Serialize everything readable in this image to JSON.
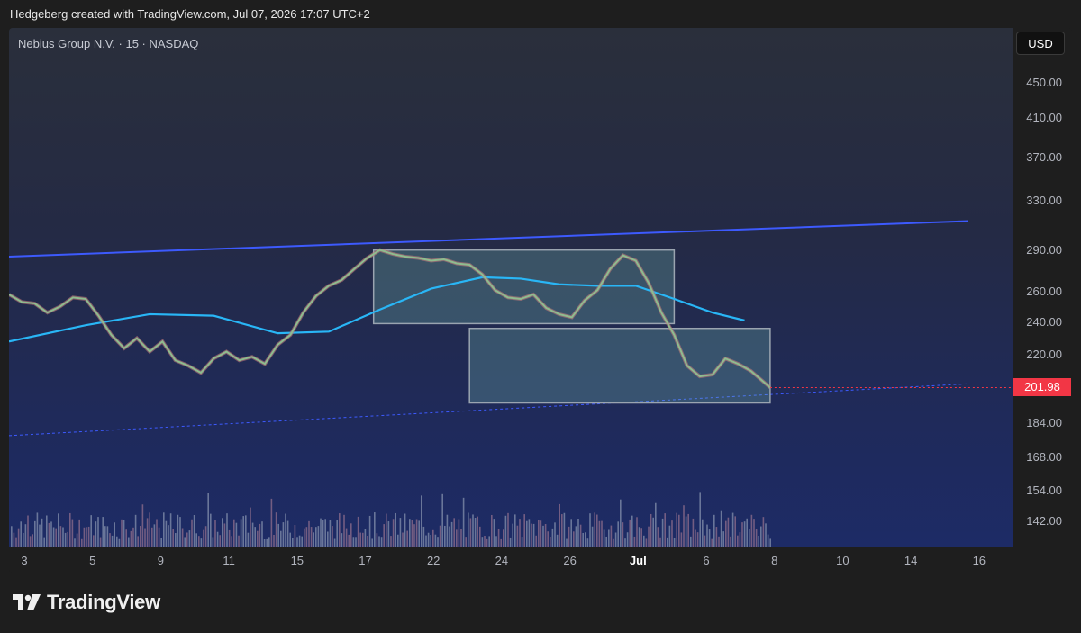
{
  "header": {
    "text": "Hedgeberg created with TradingView.com, Jul 07, 2026 17:07 UTC+2"
  },
  "legend": {
    "symbol": "Nebius Group N.V. · 15 · NASDAQ"
  },
  "currency": "USD",
  "last_price": "201.98",
  "footer": {
    "brand": "TradingView",
    "logo_icon": "tradingview-logo-icon"
  },
  "colors": {
    "trend_line": "#3d5afe",
    "ma_long": "#29b6f6",
    "ma_short": "#8fbc8f",
    "last_price_bg": "#f23645",
    "box_fill": "rgba(120,190,180,0.28)"
  },
  "chart_data": {
    "type": "line",
    "title": "",
    "xlabel": "",
    "ylabel": "",
    "scale": "log",
    "ylim": [
      133,
      520
    ],
    "price_ticks": [
      "450.00",
      "410.00",
      "370.00",
      "330.00",
      "290.00",
      "260.00",
      "240.00",
      "220.00",
      "201.98",
      "184.00",
      "168.00",
      "154.00",
      "142.00"
    ],
    "time_ticks": [
      {
        "label": "3",
        "bold": false
      },
      {
        "label": "5",
        "bold": false
      },
      {
        "label": "9",
        "bold": false
      },
      {
        "label": "11",
        "bold": false
      },
      {
        "label": "15",
        "bold": false
      },
      {
        "label": "17",
        "bold": false
      },
      {
        "label": "22",
        "bold": false
      },
      {
        "label": "24",
        "bold": false
      },
      {
        "label": "26",
        "bold": false
      },
      {
        "label": "Jul",
        "bold": true
      },
      {
        "label": "6",
        "bold": false
      },
      {
        "label": "8",
        "bold": false
      },
      {
        "label": "10",
        "bold": false
      },
      {
        "label": "14",
        "bold": false
      },
      {
        "label": "16",
        "bold": false
      }
    ],
    "price_series": [
      [
        0,
        258
      ],
      [
        2,
        253
      ],
      [
        4,
        252
      ],
      [
        6,
        246
      ],
      [
        8,
        250
      ],
      [
        10,
        256
      ],
      [
        12,
        255
      ],
      [
        14,
        244
      ],
      [
        16,
        232
      ],
      [
        18,
        224
      ],
      [
        20,
        230
      ],
      [
        22,
        222
      ],
      [
        24,
        228
      ],
      [
        26,
        217
      ],
      [
        28,
        214
      ],
      [
        30,
        210
      ],
      [
        32,
        218
      ],
      [
        34,
        222
      ],
      [
        36,
        217
      ],
      [
        38,
        219
      ],
      [
        40,
        215
      ],
      [
        42,
        226
      ],
      [
        44,
        232
      ],
      [
        46,
        246
      ],
      [
        48,
        257
      ],
      [
        50,
        264
      ],
      [
        52,
        268
      ],
      [
        54,
        276
      ],
      [
        56,
        284
      ],
      [
        58,
        290
      ],
      [
        60,
        287
      ],
      [
        62,
        285
      ],
      [
        64,
        284
      ],
      [
        66,
        282
      ],
      [
        68,
        283
      ],
      [
        70,
        280
      ],
      [
        72,
        279
      ],
      [
        74,
        272
      ],
      [
        76,
        261
      ],
      [
        78,
        256
      ],
      [
        80,
        255
      ],
      [
        82,
        258
      ],
      [
        84,
        249
      ],
      [
        86,
        245
      ],
      [
        88,
        243
      ],
      [
        90,
        254
      ],
      [
        92,
        261
      ],
      [
        94,
        276
      ],
      [
        96,
        286
      ],
      [
        98,
        282
      ],
      [
        100,
        266
      ],
      [
        102,
        246
      ],
      [
        104,
        232
      ],
      [
        106,
        214
      ],
      [
        108,
        208
      ],
      [
        110,
        209
      ],
      [
        112,
        218
      ],
      [
        114,
        215
      ],
      [
        116,
        211
      ],
      [
        118,
        205
      ],
      [
        119,
        201.98
      ]
    ],
    "ma_long": [
      [
        0,
        228
      ],
      [
        12,
        238
      ],
      [
        22,
        245
      ],
      [
        32,
        244
      ],
      [
        42,
        233
      ],
      [
        50,
        234
      ],
      [
        58,
        248
      ],
      [
        66,
        262
      ],
      [
        74,
        270
      ],
      [
        80,
        269
      ],
      [
        86,
        265
      ],
      [
        92,
        264
      ],
      [
        98,
        264
      ],
      [
        104,
        255
      ],
      [
        110,
        246
      ],
      [
        115,
        241
      ]
    ],
    "trend_upper": [
      [
        0,
        285
      ],
      [
        150,
        313
      ]
    ],
    "trend_lower": [
      [
        0,
        178
      ],
      [
        150,
        204
      ]
    ],
    "boxes": [
      {
        "x0": 57,
        "x1": 104,
        "top": 290,
        "bottom": 239
      },
      {
        "x0": 72,
        "x1": 119,
        "top": 236,
        "bottom": 194
      }
    ]
  }
}
